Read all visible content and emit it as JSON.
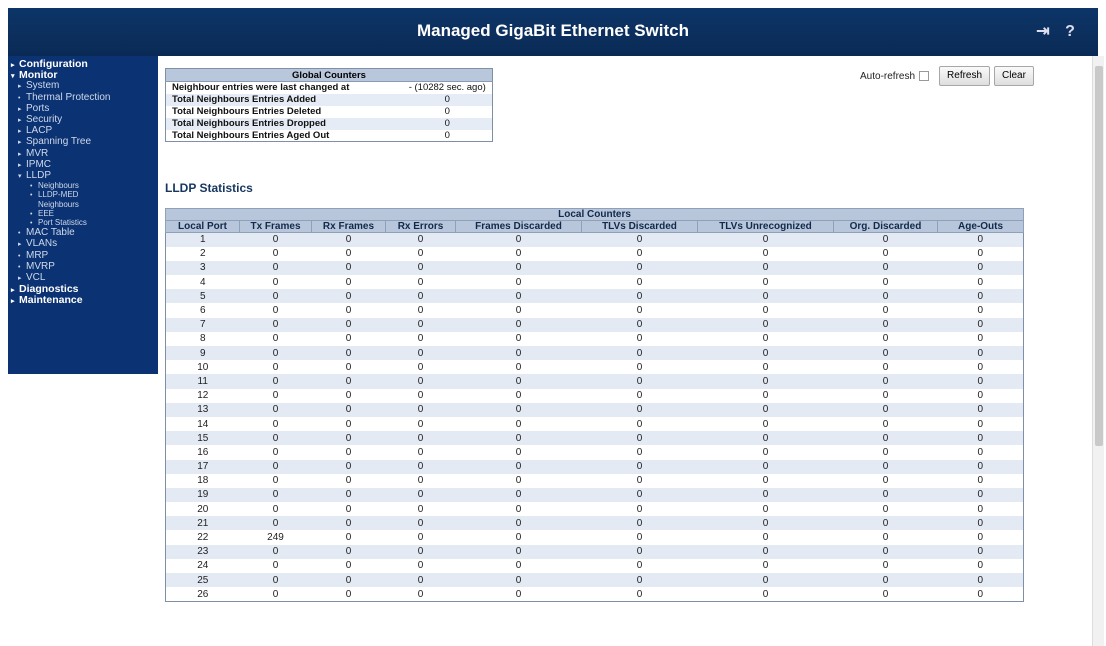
{
  "header": {
    "title": "Managed GigaBit Ethernet Switch",
    "logout_icon": "logout-icon",
    "help_icon": "help-icon"
  },
  "sidebar": {
    "items": [
      {
        "label": "Configuration",
        "level": 0,
        "arrow": "▸"
      },
      {
        "label": "Monitor",
        "level": 0,
        "arrow": "▾"
      },
      {
        "label": "System",
        "level": 1,
        "arrow": "▸"
      },
      {
        "label": "Thermal Protection",
        "level": 1,
        "arrow": "•"
      },
      {
        "label": "Ports",
        "level": 1,
        "arrow": "▸"
      },
      {
        "label": "Security",
        "level": 1,
        "arrow": "▸"
      },
      {
        "label": "LACP",
        "level": 1,
        "arrow": "▸"
      },
      {
        "label": "Spanning Tree",
        "level": 1,
        "arrow": "▸"
      },
      {
        "label": "MVR",
        "level": 1,
        "arrow": "▸"
      },
      {
        "label": "IPMC",
        "level": 1,
        "arrow": "▸"
      },
      {
        "label": "LLDP",
        "level": 1,
        "arrow": "▾"
      },
      {
        "label": "Neighbours",
        "level": 2,
        "arrow": "•"
      },
      {
        "label": "LLDP-MED",
        "level": 2,
        "arrow": "•"
      },
      {
        "label": "Neighbours",
        "level": 2,
        "arrow": ""
      },
      {
        "label": "EEE",
        "level": 2,
        "arrow": "•"
      },
      {
        "label": "Port Statistics",
        "level": 2,
        "arrow": "•"
      },
      {
        "label": "MAC Table",
        "level": 1,
        "arrow": "•"
      },
      {
        "label": "VLANs",
        "level": 1,
        "arrow": "▸"
      },
      {
        "label": "MRP",
        "level": 1,
        "arrow": "•"
      },
      {
        "label": "MVRP",
        "level": 1,
        "arrow": "•"
      },
      {
        "label": "VCL",
        "level": 1,
        "arrow": "▸"
      },
      {
        "label": "Diagnostics",
        "level": 0,
        "arrow": "▸"
      },
      {
        "label": "Maintenance",
        "level": 0,
        "arrow": "▸"
      }
    ]
  },
  "global_counters": {
    "title": "Global Counters",
    "rows": [
      {
        "label": "Neighbour entries were last changed at",
        "value": "- (10282 sec. ago)"
      },
      {
        "label": "Total Neighbours Entries Added",
        "value": "0"
      },
      {
        "label": "Total Neighbours Entries Deleted",
        "value": "0"
      },
      {
        "label": "Total Neighbours Entries Dropped",
        "value": "0"
      },
      {
        "label": "Total Neighbours Entries Aged Out",
        "value": "0"
      }
    ]
  },
  "controls": {
    "auto_refresh_label": "Auto-refresh",
    "refresh_label": "Refresh",
    "clear_label": "Clear"
  },
  "lldp": {
    "title": "LLDP Statistics",
    "group_header": "Local Counters",
    "columns": [
      "Local Port",
      "Tx Frames",
      "Rx Frames",
      "Rx Errors",
      "Frames Discarded",
      "TLVs Discarded",
      "TLVs Unrecognized",
      "Org. Discarded",
      "Age-Outs"
    ],
    "rows": [
      [
        "1",
        "0",
        "0",
        "0",
        "0",
        "0",
        "0",
        "0",
        "0"
      ],
      [
        "2",
        "0",
        "0",
        "0",
        "0",
        "0",
        "0",
        "0",
        "0"
      ],
      [
        "3",
        "0",
        "0",
        "0",
        "0",
        "0",
        "0",
        "0",
        "0"
      ],
      [
        "4",
        "0",
        "0",
        "0",
        "0",
        "0",
        "0",
        "0",
        "0"
      ],
      [
        "5",
        "0",
        "0",
        "0",
        "0",
        "0",
        "0",
        "0",
        "0"
      ],
      [
        "6",
        "0",
        "0",
        "0",
        "0",
        "0",
        "0",
        "0",
        "0"
      ],
      [
        "7",
        "0",
        "0",
        "0",
        "0",
        "0",
        "0",
        "0",
        "0"
      ],
      [
        "8",
        "0",
        "0",
        "0",
        "0",
        "0",
        "0",
        "0",
        "0"
      ],
      [
        "9",
        "0",
        "0",
        "0",
        "0",
        "0",
        "0",
        "0",
        "0"
      ],
      [
        "10",
        "0",
        "0",
        "0",
        "0",
        "0",
        "0",
        "0",
        "0"
      ],
      [
        "11",
        "0",
        "0",
        "0",
        "0",
        "0",
        "0",
        "0",
        "0"
      ],
      [
        "12",
        "0",
        "0",
        "0",
        "0",
        "0",
        "0",
        "0",
        "0"
      ],
      [
        "13",
        "0",
        "0",
        "0",
        "0",
        "0",
        "0",
        "0",
        "0"
      ],
      [
        "14",
        "0",
        "0",
        "0",
        "0",
        "0",
        "0",
        "0",
        "0"
      ],
      [
        "15",
        "0",
        "0",
        "0",
        "0",
        "0",
        "0",
        "0",
        "0"
      ],
      [
        "16",
        "0",
        "0",
        "0",
        "0",
        "0",
        "0",
        "0",
        "0"
      ],
      [
        "17",
        "0",
        "0",
        "0",
        "0",
        "0",
        "0",
        "0",
        "0"
      ],
      [
        "18",
        "0",
        "0",
        "0",
        "0",
        "0",
        "0",
        "0",
        "0"
      ],
      [
        "19",
        "0",
        "0",
        "0",
        "0",
        "0",
        "0",
        "0",
        "0"
      ],
      [
        "20",
        "0",
        "0",
        "0",
        "0",
        "0",
        "0",
        "0",
        "0"
      ],
      [
        "21",
        "0",
        "0",
        "0",
        "0",
        "0",
        "0",
        "0",
        "0"
      ],
      [
        "22",
        "249",
        "0",
        "0",
        "0",
        "0",
        "0",
        "0",
        "0"
      ],
      [
        "23",
        "0",
        "0",
        "0",
        "0",
        "0",
        "0",
        "0",
        "0"
      ],
      [
        "24",
        "0",
        "0",
        "0",
        "0",
        "0",
        "0",
        "0",
        "0"
      ],
      [
        "25",
        "0",
        "0",
        "0",
        "0",
        "0",
        "0",
        "0",
        "0"
      ],
      [
        "26",
        "0",
        "0",
        "0",
        "0",
        "0",
        "0",
        "0",
        "0"
      ]
    ]
  }
}
